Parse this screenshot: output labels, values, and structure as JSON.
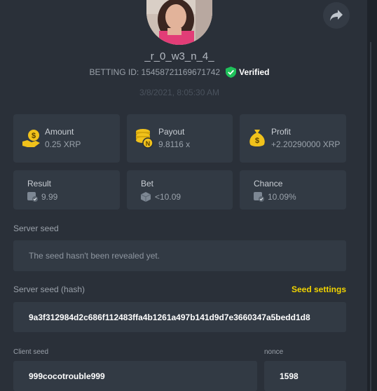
{
  "profile": {
    "username": "_r_0_w3_n_4_",
    "betting_id": "BETTING ID: 15458721169671742",
    "verified_label": "Verified",
    "timestamp": "3/8/2021, 8:05:30 AM"
  },
  "stats": {
    "amount": {
      "title": "Amount",
      "value": "0.25 XRP"
    },
    "payout": {
      "title": "Payout",
      "value": "9.8116 x"
    },
    "profit": {
      "title": "Profit",
      "value": "+2.20290000 XRP"
    },
    "result": {
      "title": "Result",
      "value": "9.99"
    },
    "bet": {
      "title": "Bet",
      "value": "<10.09"
    },
    "chance": {
      "title": "Chance",
      "value": "10.09%"
    }
  },
  "server_seed": {
    "label": "Server seed",
    "value": "The seed hasn't been revealed yet."
  },
  "server_seed_hash": {
    "label": "Server seed (hash)",
    "settings_label": "Seed settings",
    "value": "9a3f312984d2c686f112483ffa4b1261a497b141d9d7e3660347a5bedd1d8"
  },
  "client_seed": {
    "label": "Client seed",
    "value": "999cocotrouble999"
  },
  "nonce": {
    "label": "nonce",
    "value": "1598"
  },
  "colors": {
    "background": "#2a3039",
    "card": "#323a44",
    "accent_yellow": "#f1d300",
    "verified_green": "#1fc15a"
  }
}
